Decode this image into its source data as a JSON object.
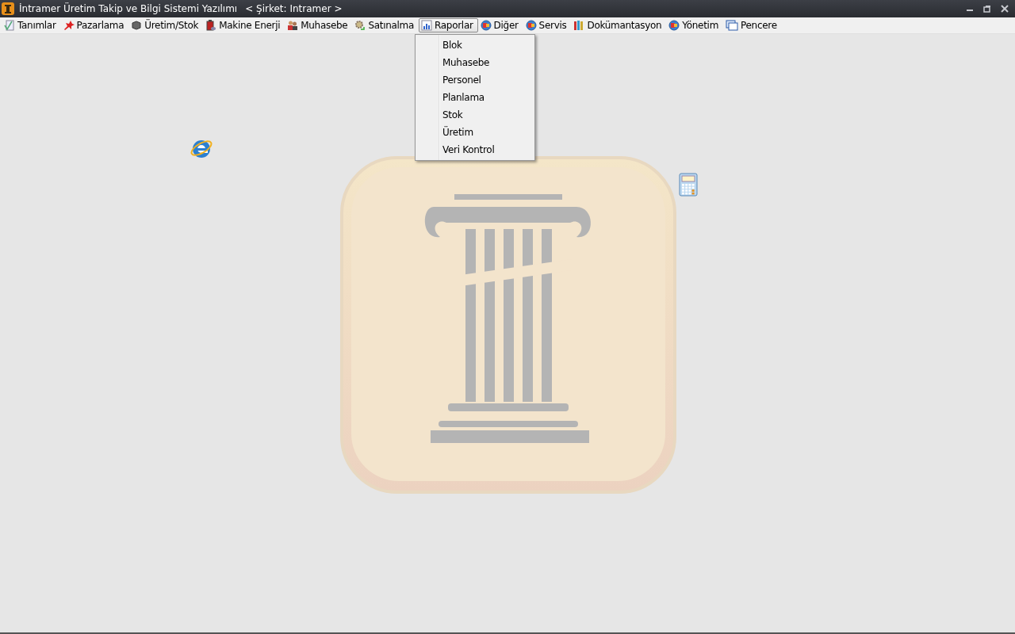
{
  "window": {
    "title": "İntramer Üretim Takip ve Bilgi Sistemi Yazılımı",
    "company": "< Şirket: Intramer >"
  },
  "menu": [
    {
      "label": "Tanımlar",
      "selected": false
    },
    {
      "label": "Pazarlama",
      "selected": false
    },
    {
      "label": "Üretim/Stok",
      "selected": false
    },
    {
      "label": "Makine Enerji",
      "selected": false
    },
    {
      "label": "Muhasebe",
      "selected": false
    },
    {
      "label": "Satınalma",
      "selected": false
    },
    {
      "label": "Raporlar",
      "selected": true
    },
    {
      "label": "Diğer",
      "selected": false
    },
    {
      "label": "Servis",
      "selected": false
    },
    {
      "label": "Dokümantasyon",
      "selected": false
    },
    {
      "label": "Yönetim",
      "selected": false
    },
    {
      "label": "Pencere",
      "selected": false
    }
  ],
  "dropdown": {
    "items": [
      "Blok",
      "Muhasebe",
      "Personel",
      "Planlama",
      "Stok",
      "Üretim",
      "Veri Kontrol"
    ]
  }
}
